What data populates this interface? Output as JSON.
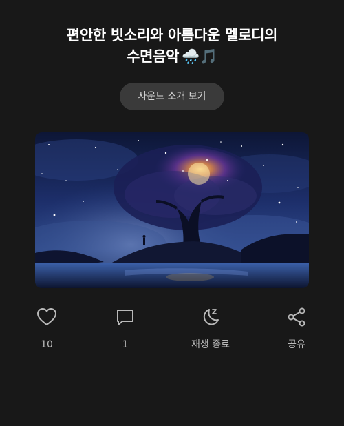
{
  "post": {
    "title_line1": "편안한 빗소리와 아름다운 멜로디의",
    "title_line2": "수면음악",
    "title_emoji": "🌧️🎵"
  },
  "intro_button": {
    "label": "사운드 소개 보기"
  },
  "artwork": {
    "description_icon": "night-sky-tree-image"
  },
  "actions": {
    "like": {
      "icon": "heart-icon",
      "label": "10"
    },
    "comment": {
      "icon": "comment-icon",
      "label": "1"
    },
    "sleep_timer": {
      "icon": "moon-sleep-icon",
      "label": "재생 종료"
    },
    "share": {
      "icon": "share-icon",
      "label": "공유"
    }
  },
  "colors": {
    "background": "#181818",
    "button_bg": "#3a3a3a",
    "icon": "#b9b9b9"
  }
}
